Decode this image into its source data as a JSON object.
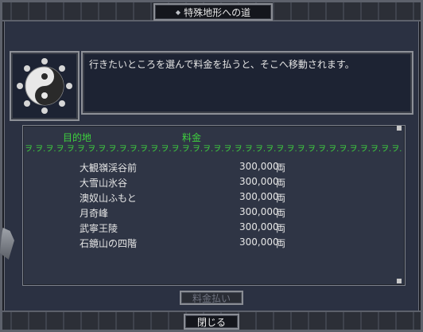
{
  "window": {
    "title": "特殊地形への道"
  },
  "message": "行きたいところを選んで料金を払うと、そこへ移動されます。",
  "list": {
    "header_destination": "目的地",
    "header_fee": "料金",
    "decoration": "ヲ.ヲ.ヲ.ヲ.ヲ.ヲ.ヲ.ヲ.ヲ.ヲ.ヲ.ヲ.ヲ.ヲ.ヲ.ヲ.ヲ.ヲ.ヲ.ヲ.ヲ.ヲ.ヲ.ヲ.ヲ.ヲ.ヲ.ヲ.ヲ.ヲ.ヲ.ヲ.ヲ.ヲ.ヲ.ヲ.ヲ.",
    "rows": [
      {
        "destination": "大観嶺渓谷前",
        "fee": "300,000",
        "unit": "両"
      },
      {
        "destination": "大雪山氷谷",
        "fee": "300,000",
        "unit": "両"
      },
      {
        "destination": "澳奴山ふもと",
        "fee": "300,000",
        "unit": "両"
      },
      {
        "destination": "月奇峰",
        "fee": "300,000",
        "unit": "両"
      },
      {
        "destination": "武寧王陵",
        "fee": "300,000",
        "unit": "両"
      },
      {
        "destination": "石鏡山の四階",
        "fee": "300,000",
        "unit": "両"
      }
    ]
  },
  "buttons": {
    "pay_label": "料金払い",
    "close_label": "閉じる"
  },
  "icons": {
    "emblem": "yin-yang-icon"
  },
  "colors": {
    "header_green": "#3ed13e",
    "panel_bg": "#2b3142"
  }
}
